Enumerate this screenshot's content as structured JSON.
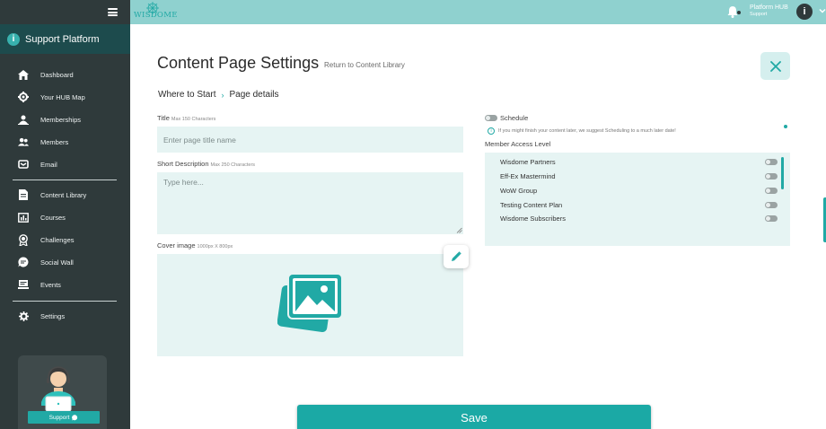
{
  "sidebar": {
    "brand_title": "Support Platform",
    "brand_icon": "i",
    "items": [
      {
        "label": "Dashboard",
        "icon": "home-icon"
      },
      {
        "label": "Your HUB Map",
        "icon": "hub-map-icon"
      },
      {
        "label": "Memberships",
        "icon": "memberships-icon"
      },
      {
        "label": "Members",
        "icon": "members-icon"
      },
      {
        "label": "Email",
        "icon": "email-icon"
      },
      {
        "label": "Content Library",
        "icon": "content-library-icon"
      },
      {
        "label": "Courses",
        "icon": "courses-icon"
      },
      {
        "label": "Challenges",
        "icon": "challenges-icon"
      },
      {
        "label": "Social Wall",
        "icon": "social-wall-icon"
      },
      {
        "label": "Events",
        "icon": "events-icon"
      },
      {
        "label": "Settings",
        "icon": "gear-icon"
      }
    ],
    "support_label": "Support"
  },
  "topbar": {
    "logo_text": "WISDOME",
    "hub_title": "Platform HUB",
    "hub_subtitle": "Support",
    "info_glyph": "i"
  },
  "main": {
    "title": "Content Page Settings",
    "return_link": "Return to Content Library",
    "breadcrumb": [
      "Where to Start",
      "Page details"
    ],
    "breadcrumb_sep": "›",
    "title_field": {
      "label": "Title",
      "hint": "Max 150 Characters",
      "placeholder": "Enter page title name"
    },
    "description_field": {
      "label": "Short Description",
      "hint": "Max 250 Characters",
      "placeholder": "Type here..."
    },
    "cover_field": {
      "label": "Cover image",
      "hint": "1000px X 800px"
    },
    "schedule": {
      "label": "Schedule",
      "note": "If you might finish your content later, we suggest Scheduling to a much later date!",
      "enabled": false
    },
    "access": {
      "label": "Member Access Level",
      "groups": [
        {
          "name": "Wisdome Partners",
          "enabled": false
        },
        {
          "name": "Eff-Ex Mastermind",
          "enabled": false
        },
        {
          "name": "WoW Group",
          "enabled": false
        },
        {
          "name": "Testing Content Plan",
          "enabled": false
        },
        {
          "name": "Wisdome Subscribers",
          "enabled": false
        }
      ]
    },
    "save_label": "Save"
  },
  "colors": {
    "accent": "#1ba9a5",
    "sidebar_bg": "#2f3a3b",
    "topbar_bg": "#8fd1cf",
    "field_bg": "#e6f4f3"
  }
}
